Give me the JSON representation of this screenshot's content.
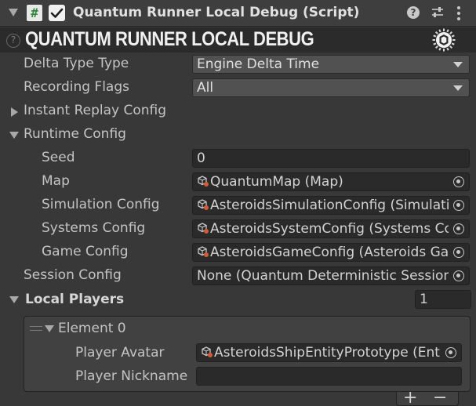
{
  "header": {
    "title": "Quantum Runner Local Debug (Script)",
    "script_glyph": "#",
    "enabled": true,
    "help_glyph": "?"
  },
  "banner": {
    "title": "QUANTUM RUNNER LOCAL DEBUG",
    "hint_glyph": "?"
  },
  "fields": {
    "delta_type": {
      "label": "Delta Type Type",
      "value": "Engine Delta Time"
    },
    "recording_flags": {
      "label": "Recording Flags",
      "value": "All"
    },
    "instant_replay": {
      "label": "Instant Replay Config"
    },
    "runtime_config": {
      "label": "Runtime Config"
    },
    "seed": {
      "label": "Seed",
      "value": "0"
    },
    "map": {
      "label": "Map",
      "value": "QuantumMap (Map)"
    },
    "simulation_config": {
      "label": "Simulation Config",
      "value": "AsteroidsSimulationConfig (Simulation Config)"
    },
    "systems_config": {
      "label": "Systems Config",
      "value": "AsteroidsSystemConfig (Systems Config)"
    },
    "game_config": {
      "label": "Game Config",
      "value": "AsteroidsGameConfig (Asteroids Game Config)"
    },
    "session_config": {
      "label": "Session Config",
      "value": "None (Quantum Deterministic Session Config)"
    }
  },
  "local_players": {
    "label": "Local Players",
    "count": "1",
    "element": {
      "label": "Element 0",
      "player_avatar": {
        "label": "Player Avatar",
        "value": "AsteroidsShipEntityPrototype (Entity Prototype)"
      },
      "player_nickname": {
        "label": "Player Nickname",
        "value": ""
      }
    },
    "add_glyph": "+",
    "remove_glyph": "−"
  }
}
